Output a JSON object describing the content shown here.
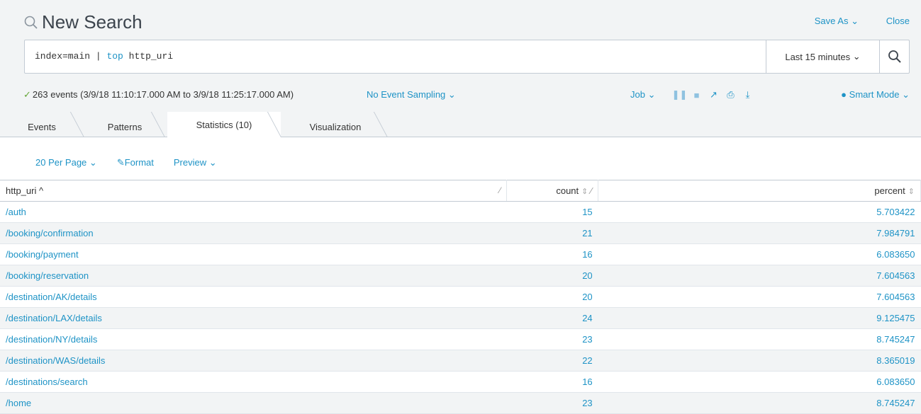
{
  "header": {
    "title": "New Search",
    "save_as": "Save As",
    "close": "Close"
  },
  "search": {
    "query_prefix": "index=main",
    "query_pipe": "|",
    "query_keyword": "top",
    "query_suffix": "http_uri",
    "time_range": "Last 15 minutes"
  },
  "status": {
    "text": "263 events (3/9/18 11:10:17.000 AM to 3/9/18 11:25:17.000 AM)",
    "sampling": "No Event Sampling",
    "job": "Job",
    "mode": "Smart Mode"
  },
  "tabs": [
    {
      "label": "Events"
    },
    {
      "label": "Patterns"
    },
    {
      "label": "Statistics (10)"
    },
    {
      "label": "Visualization"
    }
  ],
  "toolbar": {
    "per_page": "20 Per Page",
    "format": "Format",
    "preview": "Preview"
  },
  "table": {
    "columns": [
      "http_uri ^",
      "count",
      "percent"
    ],
    "rows": [
      {
        "uri": "/auth",
        "count": "15",
        "percent": "5.703422"
      },
      {
        "uri": "/booking/confirmation",
        "count": "21",
        "percent": "7.984791"
      },
      {
        "uri": "/booking/payment",
        "count": "16",
        "percent": "6.083650"
      },
      {
        "uri": "/booking/reservation",
        "count": "20",
        "percent": "7.604563"
      },
      {
        "uri": "/destination/AK/details",
        "count": "20",
        "percent": "7.604563"
      },
      {
        "uri": "/destination/LAX/details",
        "count": "24",
        "percent": "9.125475"
      },
      {
        "uri": "/destination/NY/details",
        "count": "23",
        "percent": "8.745247"
      },
      {
        "uri": "/destination/WAS/details",
        "count": "22",
        "percent": "8.365019"
      },
      {
        "uri": "/destinations/search",
        "count": "16",
        "percent": "6.083650"
      },
      {
        "uri": "/home",
        "count": "23",
        "percent": "8.745247"
      }
    ]
  },
  "colors": {
    "link": "#1e93c6",
    "success": "#65a637",
    "panel_bg": "#f2f4f5"
  }
}
